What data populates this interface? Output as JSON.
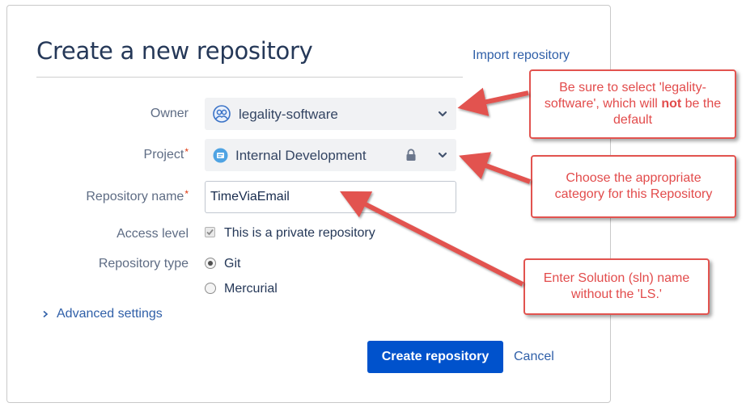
{
  "dialog": {
    "title": "Create a new repository",
    "import_link": "Import repository"
  },
  "form": {
    "owner": {
      "label": "Owner",
      "value": "legality-software"
    },
    "project": {
      "label": "Project",
      "value": "Internal Development",
      "required_mark": "*"
    },
    "repo_name": {
      "label": "Repository name",
      "value": "TimeViaEmail",
      "required_mark": "*"
    },
    "access": {
      "label": "Access level",
      "checkbox_label": "This is a private repository",
      "checked": true
    },
    "repo_type": {
      "label": "Repository type",
      "options": [
        {
          "label": "Git",
          "selected": true
        },
        {
          "label": "Mercurial",
          "selected": false
        }
      ]
    },
    "advanced": "Advanced settings"
  },
  "actions": {
    "create_label": "Create repository",
    "cancel_label": "Cancel"
  },
  "annotations": {
    "owner_pre": "Be sure to select 'legality-software', which will ",
    "owner_bold": "not",
    "owner_post": " be the default",
    "project": "Choose the appropriate category for this Repository",
    "name": "Enter Solution (sln) name without the 'LS.'"
  },
  "colors": {
    "primary": "#0052cc",
    "link": "#2f5fa8",
    "annotation": "#e24b4b",
    "required": "#de350b"
  }
}
